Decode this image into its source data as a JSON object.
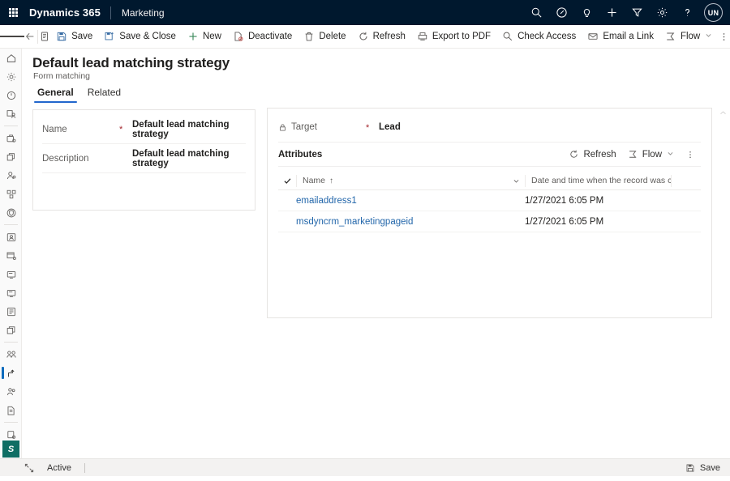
{
  "topbar": {
    "waffle": "app-launcher",
    "brand": "Dynamics 365",
    "app_name": "Marketing",
    "icons": [
      {
        "name": "search-icon",
        "label": "Search"
      },
      {
        "name": "assistant-icon",
        "label": "Assistant"
      },
      {
        "name": "lightbulb-icon",
        "label": "Ideas"
      },
      {
        "name": "add-icon",
        "label": "New"
      },
      {
        "name": "filter-icon",
        "label": "Filter"
      },
      {
        "name": "settings-gear-icon",
        "label": "Settings"
      },
      {
        "name": "help-question-icon",
        "label": "Help"
      }
    ],
    "avatar_initials": "UN"
  },
  "commandbar": {
    "buttons": [
      {
        "name": "save-button",
        "label": "Save",
        "icon": "save-icon"
      },
      {
        "name": "save-and-close-button",
        "label": "Save & Close",
        "icon": "save-close-icon"
      },
      {
        "name": "new-button",
        "label": "New",
        "icon": "plus-icon"
      },
      {
        "name": "deactivate-button",
        "label": "Deactivate",
        "icon": "deactivate-icon"
      },
      {
        "name": "delete-button",
        "label": "Delete",
        "icon": "trash-icon"
      },
      {
        "name": "refresh-button",
        "label": "Refresh",
        "icon": "refresh-icon"
      },
      {
        "name": "export-to-pdf-button",
        "label": "Export to PDF",
        "icon": "pdf-icon"
      },
      {
        "name": "check-access-button",
        "label": "Check Access",
        "icon": "magnifier-icon"
      },
      {
        "name": "email-a-link-button",
        "label": "Email a Link",
        "icon": "email-icon"
      },
      {
        "name": "flow-button",
        "label": "Flow",
        "icon": "flow-icon",
        "chevron": true
      }
    ],
    "overflow": "more-commands-icon"
  },
  "rail": {
    "items": [
      {
        "name": "sidebar-item-home",
        "icon": "home-icon",
        "selected": false
      },
      {
        "name": "sidebar-item-settings",
        "icon": "gear-icon",
        "selected": false
      },
      {
        "name": "sidebar-item-recent",
        "icon": "clock-icon",
        "selected": false
      },
      {
        "name": "sidebar-item-pinned",
        "icon": "pin-person-icon",
        "selected": false
      },
      {
        "name": "sidebar-item-accounts",
        "icon": "briefcase-icon",
        "selected": false
      },
      {
        "name": "sidebar-item-contacts",
        "icon": "copy-icon",
        "selected": false
      },
      {
        "name": "sidebar-item-leads",
        "icon": "person-add-icon",
        "selected": false
      },
      {
        "name": "sidebar-item-segments",
        "icon": "segments-icon",
        "selected": false
      },
      {
        "name": "sidebar-item-subscription",
        "icon": "shield-icon",
        "selected": false
      },
      {
        "name": "sidebar-item-customer-journeys",
        "icon": "journey-icon",
        "selected": false
      },
      {
        "name": "sidebar-item-marketing-emails",
        "icon": "email-page-icon",
        "selected": false
      },
      {
        "name": "sidebar-item-marketing-pages",
        "icon": "page-icon",
        "selected": false
      },
      {
        "name": "sidebar-item-marketing-pages-2",
        "icon": "page-icon",
        "selected": false
      },
      {
        "name": "sidebar-item-marketing-forms",
        "icon": "form-icon",
        "selected": false
      },
      {
        "name": "sidebar-item-templates",
        "icon": "layers-icon",
        "selected": false
      },
      {
        "name": "sidebar-item-social-posts",
        "icon": "social-icon",
        "selected": false
      },
      {
        "name": "sidebar-item-form-matching",
        "icon": "branch-flow-icon",
        "selected": true
      },
      {
        "name": "sidebar-item-teams",
        "icon": "people-icon",
        "selected": false
      },
      {
        "name": "sidebar-item-reports",
        "icon": "report-icon",
        "selected": false
      },
      {
        "name": "sidebar-item-data-settings",
        "icon": "database-gear-icon",
        "selected": false
      },
      {
        "name": "sidebar-item-hierarchy",
        "icon": "hierarchy-icon",
        "selected": false
      },
      {
        "name": "sidebar-item-toggle",
        "icon": "toggle-icon",
        "selected": false
      }
    ],
    "area_button": "S"
  },
  "page": {
    "title": "Default lead matching strategy",
    "subtitle": "Form matching",
    "tabs": [
      {
        "name": "tab-general",
        "label": "General",
        "active": true
      },
      {
        "name": "tab-related",
        "label": "Related",
        "active": false
      }
    ]
  },
  "left_card": {
    "fields": [
      {
        "name_key": "name-field",
        "label": "Name",
        "required": "*",
        "value": "Default lead matching strategy"
      },
      {
        "name_key": "description-field",
        "label": "Description",
        "required": "",
        "value": "Default lead matching strategy"
      }
    ]
  },
  "right_card": {
    "target": {
      "label": "Target",
      "required": "*",
      "value": "Lead",
      "lock_icon": "lock-icon"
    },
    "attributes": {
      "title": "Attributes",
      "tools": [
        {
          "name": "attributes-refresh-button",
          "label": "Refresh",
          "icon": "refresh-icon"
        },
        {
          "name": "attributes-flow-button",
          "label": "Flow",
          "icon": "flow-icon",
          "chevron": true
        }
      ],
      "overflow": "more-commands-icon",
      "grid": {
        "columns": [
          {
            "name": "column-name",
            "label": "Name",
            "sort": "↑"
          },
          {
            "name": "column-created-on",
            "label": "Date and time when the record was created",
            "sort": ""
          }
        ],
        "rows": [
          {
            "name": "emailaddress1",
            "created": "1/27/2021 6:05 PM"
          },
          {
            "name": "msdyncrm_marketingpageid",
            "created": "1/27/2021 6:05 PM"
          }
        ]
      }
    }
  },
  "statusbar": {
    "expand_icon": "expand-icon",
    "state": "Active",
    "save_label": "Save",
    "save_icon": "save-icon"
  },
  "colors": {
    "header_bg": "#00182e",
    "accent": "#2266cc",
    "link": "#2266aa",
    "required": "#a4262c",
    "rail_selected": "#0f6cbd",
    "area_badge": "#0f6e64"
  }
}
